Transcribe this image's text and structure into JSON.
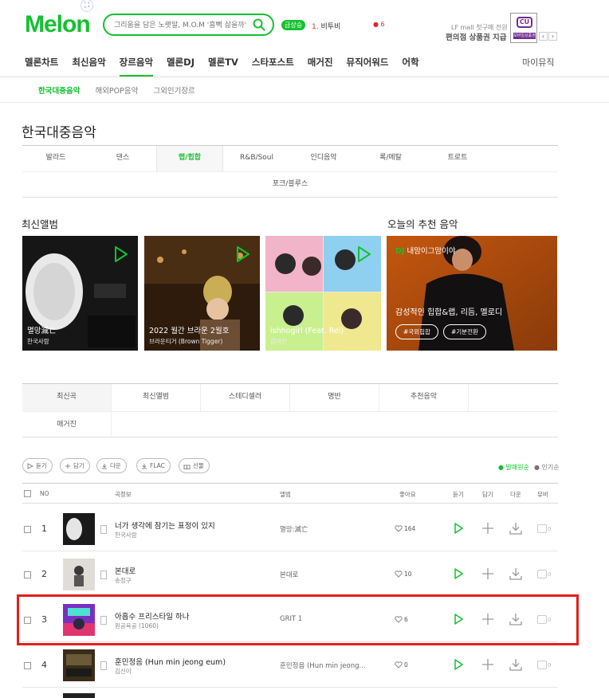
{
  "header": {
    "logo": "Melon",
    "logo_badge": "⛶",
    "search_placeholder": "그리움을 담은 노랫말, M.O.M '흠뻑 삶을까'",
    "realtime_badge": "급상승",
    "realtime_rank": "1.",
    "realtime_text": "비투비",
    "realtime_dot": "● 6",
    "ad_sub": "LF mall 첫구매 전원",
    "ad_main": "편의점 상품권 지급",
    "ad_logo": "CU",
    "ad_tag": "모바일상품권",
    "ad_prev": "‹",
    "ad_next": "›"
  },
  "gnb": {
    "items": [
      "멜론차트",
      "최신음악",
      "장르음악",
      "멜론DJ",
      "멜론TV",
      "스타포스트",
      "매거진",
      "뮤직어워드",
      "어학"
    ],
    "active_index": 2,
    "right": "마이뮤직"
  },
  "sub_nav": {
    "items": [
      "한국대중음악",
      "해외POP음악",
      "그외인기장르"
    ],
    "active_index": 0
  },
  "page_title": "한국대중음악",
  "genres": {
    "row1": [
      "발라드",
      "댄스",
      "랩/힙합",
      "R&B/Soul",
      "인디음악",
      "록/메탈",
      "트로트"
    ],
    "row2": "포크/블루스",
    "active_index": 2
  },
  "latest_albums": {
    "title": "최신앨범",
    "items": [
      {
        "title": "멸망滅亡",
        "artist": "한국사람"
      },
      {
        "title": "2022 월간 브라운 2월호",
        "artist": "브라운티거 (Brown Tigger)"
      },
      {
        "title": "ishhogirl (Feat. Rei)",
        "artist": "김아진"
      }
    ]
  },
  "recommend": {
    "title": "오늘의 추천 음악",
    "dj_label": "DJ",
    "dj_name": "내맘이그맘이야",
    "headline": "감성적인 힙합&랩, 리듬, 멜로디",
    "tags": [
      "#국외힙합",
      "#기분전환"
    ]
  },
  "tabs": {
    "row1": [
      "최신곡",
      "최신앨범",
      "스테디셀러",
      "명반",
      "추천음악"
    ],
    "row2": [
      "매거진"
    ],
    "active_index": 0
  },
  "toolbar": {
    "buttons": [
      "듣기",
      "담기",
      "다운",
      "FLAC",
      "선물"
    ],
    "sort_options": [
      "● 발매원순",
      "● 인기순"
    ],
    "sort_active": 0
  },
  "table_head": {
    "no": "NO",
    "song": "곡정보",
    "album": "앨범",
    "like": "좋아요",
    "listen": "듣기",
    "add": "담기",
    "download": "다운",
    "mv": "뮤비"
  },
  "songs": [
    {
      "rank": "1",
      "title": "너가 생각에 잠기는 표정이 있지",
      "artist": "한국사람",
      "album": "멸망:滅亡",
      "likes": "164",
      "mv": "0"
    },
    {
      "rank": "2",
      "title": "본대로",
      "artist": "송정구",
      "album": "본대로",
      "likes": "10",
      "mv": "0"
    },
    {
      "rank": "3",
      "title": "아홉수 프리스타일 하나",
      "artist": "원공육공 (1060)",
      "album": "GRIT 1",
      "likes": "6",
      "mv": "0"
    },
    {
      "rank": "4",
      "title": "훈민정음 (Hun min jeong eum)",
      "artist": "김신이",
      "album": "훈민정음 (Hun min jeong...",
      "likes": "0",
      "mv": "0"
    }
  ],
  "colors": {
    "brand": "#14c131",
    "highlight": "#e0201c"
  }
}
